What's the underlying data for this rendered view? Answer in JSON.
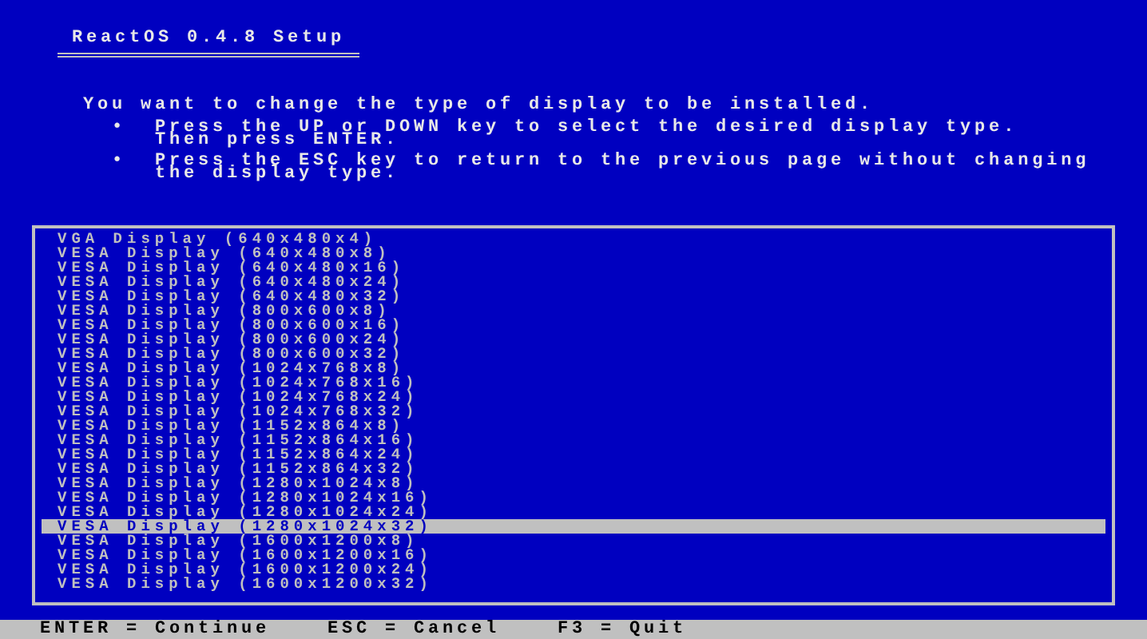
{
  "title": "ReactOS 0.4.8 Setup",
  "intro": "You want to change the type of display to be installed.",
  "bullets": [
    {
      "marker": "•",
      "lines": [
        "Press the UP or DOWN key to select the desired display type.",
        "Then press ENTER."
      ]
    },
    {
      "marker": "•",
      "lines": [
        "Press the ESC key to return to the previous page without changing",
        "the display type."
      ]
    }
  ],
  "display_list": [
    {
      "label": "VGA Display (640x480x4)",
      "selected": false
    },
    {
      "label": "VESA Display (640x480x8)",
      "selected": false
    },
    {
      "label": "VESA Display (640x480x16)",
      "selected": false
    },
    {
      "label": "VESA Display (640x480x24)",
      "selected": false
    },
    {
      "label": "VESA Display (640x480x32)",
      "selected": false
    },
    {
      "label": "VESA Display (800x600x8)",
      "selected": false
    },
    {
      "label": "VESA Display (800x600x16)",
      "selected": false
    },
    {
      "label": "VESA Display (800x600x24)",
      "selected": false
    },
    {
      "label": "VESA Display (800x600x32)",
      "selected": false
    },
    {
      "label": "VESA Display (1024x768x8)",
      "selected": false
    },
    {
      "label": "VESA Display (1024x768x16)",
      "selected": false
    },
    {
      "label": "VESA Display (1024x768x24)",
      "selected": false
    },
    {
      "label": "VESA Display (1024x768x32)",
      "selected": false
    },
    {
      "label": "VESA Display (1152x864x8)",
      "selected": false
    },
    {
      "label": "VESA Display (1152x864x16)",
      "selected": false
    },
    {
      "label": "VESA Display (1152x864x24)",
      "selected": false
    },
    {
      "label": "VESA Display (1152x864x32)",
      "selected": false
    },
    {
      "label": "VESA Display (1280x1024x8)",
      "selected": false
    },
    {
      "label": "VESA Display (1280x1024x16)",
      "selected": false
    },
    {
      "label": "VESA Display (1280x1024x24)",
      "selected": false
    },
    {
      "label": "VESA Display (1280x1024x32)",
      "selected": true
    },
    {
      "label": "VESA Display (1600x1200x8)",
      "selected": false
    },
    {
      "label": "VESA Display (1600x1200x16)",
      "selected": false
    },
    {
      "label": "VESA Display (1600x1200x24)",
      "selected": false
    },
    {
      "label": "VESA Display (1600x1200x32)",
      "selected": false
    }
  ],
  "status_bar": [
    "ENTER = Continue",
    "ESC = Cancel",
    "F3 = Quit"
  ]
}
